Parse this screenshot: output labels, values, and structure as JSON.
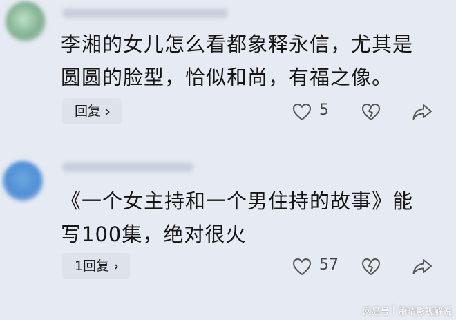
{
  "comments": [
    {
      "text": "李湘的女儿怎么看都象释永信，尤其是圆圆的脸型，恰似和尚，有福之像。",
      "reply_label": "回复",
      "reply_chevron": "›",
      "like_count": "5",
      "icons": [
        "heart-icon",
        "broken-heart-icon",
        "share-arrow-icon"
      ]
    },
    {
      "text": "《一个女主持和一个男住持的故事》能写100集，绝对很火",
      "reply_label": "1回复",
      "reply_chevron": "›",
      "like_count": "57",
      "icons": [
        "heart-icon",
        "broken-heart-icon",
        "share-arrow-icon"
      ]
    }
  ],
  "watermark": {
    "brand": "网易号",
    "separator": "|",
    "author": "萧晴影视解说"
  },
  "colors": {
    "background": "#e6eaf2",
    "reply_button_bg": "#dde2eb",
    "text": "#151515"
  }
}
